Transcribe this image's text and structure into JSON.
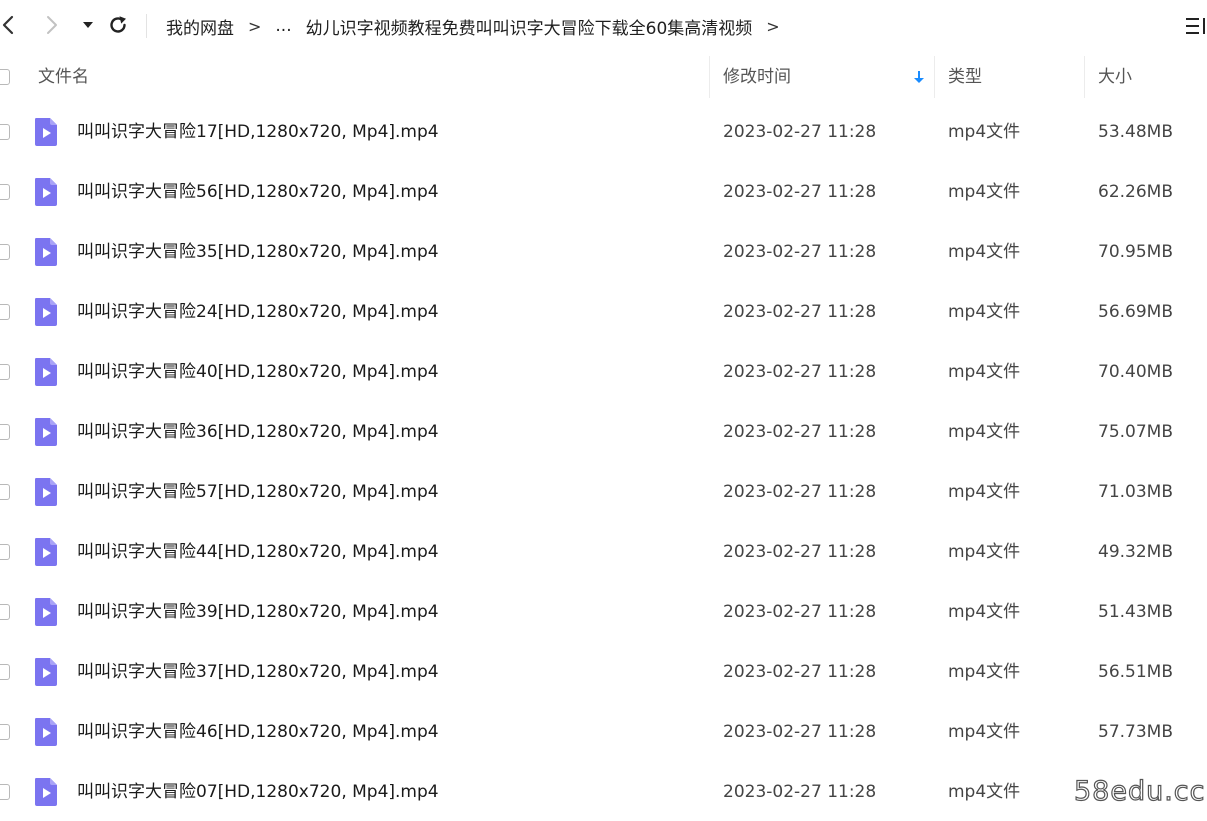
{
  "toolbar": {
    "back_icon": "chevron-left-icon",
    "forward_icon": "chevron-right-icon",
    "dropdown_icon": "caret-down-icon",
    "refresh_icon": "refresh-icon",
    "view_toggle_icon": "list-view-icon"
  },
  "breadcrumb": {
    "root": "我的网盘",
    "separator": ">",
    "ellipsis": "...",
    "current": "幼儿识字视频教程免费叫叫识字大冒险下载全60集高清视频",
    "trailing_separator": ">"
  },
  "columns": {
    "name": "文件名",
    "modified": "修改时间",
    "type": "类型",
    "size": "大小",
    "sort_icon": "sort-descending-arrow-icon"
  },
  "colors": {
    "accent": "#1a8cff",
    "file_icon": "#7b74f0"
  },
  "files": [
    {
      "name": "叫叫识字大冒险17[HD,1280x720, Mp4].mp4",
      "modified": "2023-02-27 11:28",
      "type": "mp4文件",
      "size": "53.48MB"
    },
    {
      "name": "叫叫识字大冒险56[HD,1280x720, Mp4].mp4",
      "modified": "2023-02-27 11:28",
      "type": "mp4文件",
      "size": "62.26MB"
    },
    {
      "name": "叫叫识字大冒险35[HD,1280x720, Mp4].mp4",
      "modified": "2023-02-27 11:28",
      "type": "mp4文件",
      "size": "70.95MB"
    },
    {
      "name": "叫叫识字大冒险24[HD,1280x720, Mp4].mp4",
      "modified": "2023-02-27 11:28",
      "type": "mp4文件",
      "size": "56.69MB"
    },
    {
      "name": "叫叫识字大冒险40[HD,1280x720, Mp4].mp4",
      "modified": "2023-02-27 11:28",
      "type": "mp4文件",
      "size": "70.40MB"
    },
    {
      "name": "叫叫识字大冒险36[HD,1280x720, Mp4].mp4",
      "modified": "2023-02-27 11:28",
      "type": "mp4文件",
      "size": "75.07MB"
    },
    {
      "name": "叫叫识字大冒险57[HD,1280x720, Mp4].mp4",
      "modified": "2023-02-27 11:28",
      "type": "mp4文件",
      "size": "71.03MB"
    },
    {
      "name": "叫叫识字大冒险44[HD,1280x720, Mp4].mp4",
      "modified": "2023-02-27 11:28",
      "type": "mp4文件",
      "size": "49.32MB"
    },
    {
      "name": "叫叫识字大冒险39[HD,1280x720, Mp4].mp4",
      "modified": "2023-02-27 11:28",
      "type": "mp4文件",
      "size": "51.43MB"
    },
    {
      "name": "叫叫识字大冒险37[HD,1280x720, Mp4].mp4",
      "modified": "2023-02-27 11:28",
      "type": "mp4文件",
      "size": "56.51MB"
    },
    {
      "name": "叫叫识字大冒险46[HD,1280x720, Mp4].mp4",
      "modified": "2023-02-27 11:28",
      "type": "mp4文件",
      "size": "57.73MB"
    },
    {
      "name": "叫叫识字大冒险07[HD,1280x720, Mp4].mp4",
      "modified": "2023-02-27 11:28",
      "type": "mp4文件",
      "size": ""
    }
  ],
  "watermark": "58edu.cc"
}
